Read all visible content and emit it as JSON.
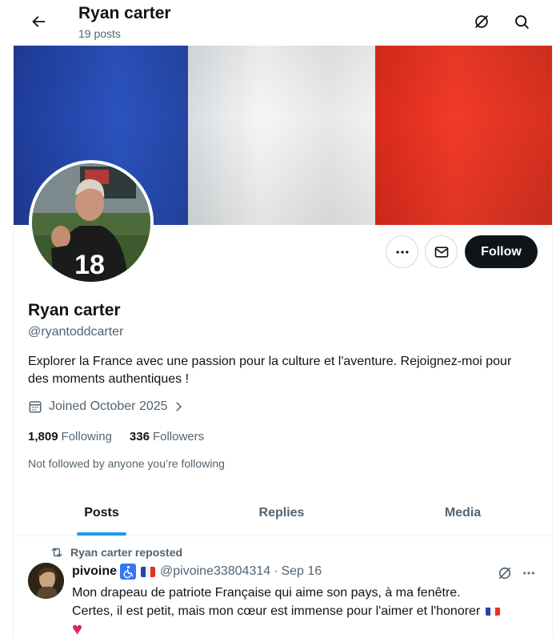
{
  "header": {
    "title": "Ryan carter",
    "posts_count": "19 posts"
  },
  "banner": {
    "colors": [
      "#2544a8",
      "#f1f1f1",
      "#e53121"
    ]
  },
  "profile": {
    "name": "Ryan carter",
    "handle": "@ryantoddcarter",
    "bio": "Explorer la France avec une passion pour la culture et l'aventure. Rejoignez-moi pour des moments authentiques !",
    "joined": "Joined October 2025",
    "following_count": "1,809",
    "following_label": "Following",
    "followers_count": "336",
    "followers_label": "Followers",
    "not_followed": "Not followed by anyone you’re following",
    "avatar_jersey_number": "18"
  },
  "actions": {
    "follow_label": "Follow"
  },
  "tabs": [
    {
      "label": "Posts",
      "active": true
    },
    {
      "label": "Replies",
      "active": false
    },
    {
      "label": "Media",
      "active": false
    }
  ],
  "post": {
    "repost_label": "Ryan carter reposted",
    "author_name": "pivoine",
    "author_handle": "@pivoine33804314",
    "separator": "·",
    "date": "Sep 16",
    "text_line1": "Mon drapeau de patriote Française qui aime son  pays, à ma fenêtre.",
    "text_line2": "Certes, il est petit, mais mon cœur est immense pour l'aimer et l'honorer",
    "heart": "♥"
  },
  "colors": {
    "accent": "#1d9bf0",
    "text_primary": "#0f1419",
    "text_secondary": "#536471",
    "heart": "#e0245e"
  }
}
